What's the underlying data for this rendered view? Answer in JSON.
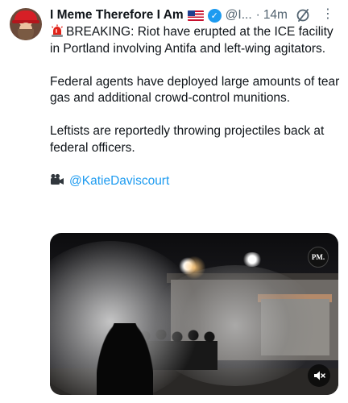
{
  "tweet": {
    "author_name": "I Meme Therefore I Am",
    "handle": "@I...",
    "separator": "·",
    "time": "14m",
    "text": {
      "p1": "BREAKING: Riot have erupted at the ICE facility in Portland involving Antifa and left-wing agitators.",
      "p2": "Federal agents have deployed large amounts of tear gas and additional crowd-control munitions.",
      "p3": "Leftists are reportedly throwing projectiles back at federal officers.",
      "credit": "@KatieDaviscourt"
    },
    "media": {
      "badge": "PM."
    }
  },
  "icons": {
    "flag": "us-flag-icon",
    "verified": "verified-badge-icon",
    "grok": "slash-circle-icon",
    "more": "more-options-icon",
    "siren": "siren-icon",
    "camera": "video-camera-icon",
    "mute": "muted-speaker-icon"
  },
  "colors": {
    "link": "#1d9bf0",
    "verified": "#1d9bf0",
    "secondary_text": "#536471"
  }
}
